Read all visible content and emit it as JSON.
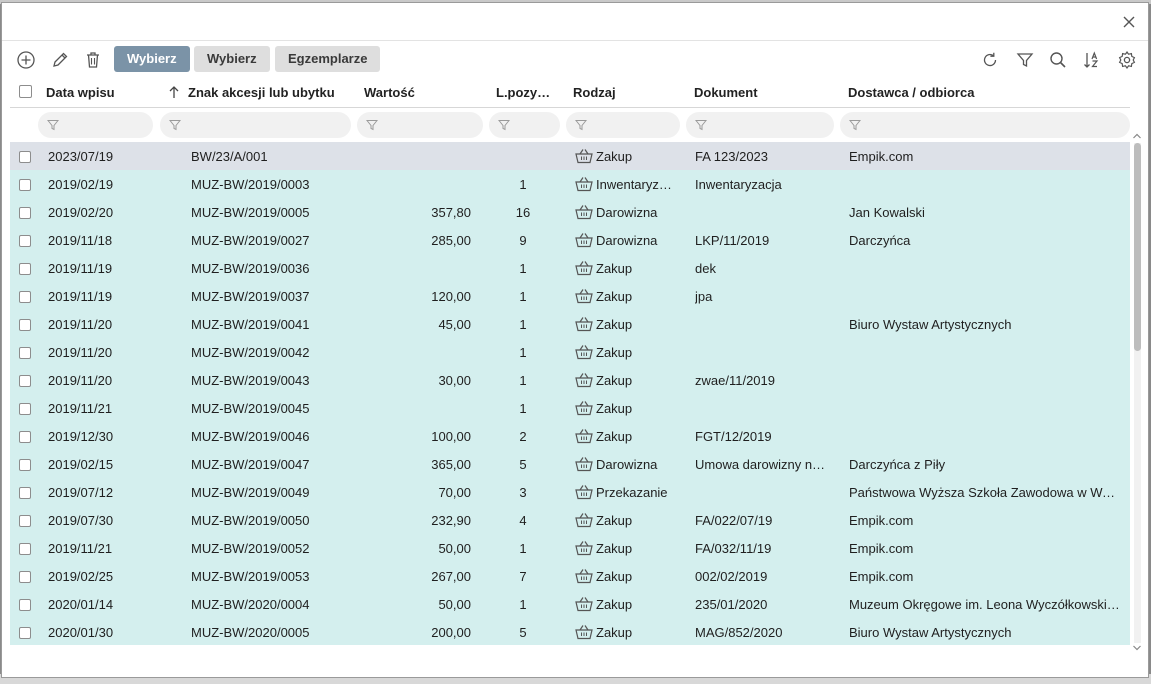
{
  "toolbar": {
    "buttons": [
      "Wybierz",
      "Wybierz",
      "Egzemplarze"
    ]
  },
  "columns": {
    "date": "Data wpisu",
    "sign": "Znak akcesji lub ubytku",
    "value": "Wartość",
    "positions": "L.pozy…",
    "type": "Rodzaj",
    "document": "Dokument",
    "supplier": "Dostawca / odbiorca"
  },
  "sort": {
    "column": "sign",
    "direction": "ascending"
  },
  "colors": {
    "row_bg": "#d4efee",
    "selected_row_bg": "#dde1e8",
    "primary_button": "#7b93a7"
  },
  "rows": [
    {
      "date": "2023/07/19",
      "sign": "BW/23/A/001",
      "value": "",
      "positions": "",
      "type": "Zakup",
      "document": "FA 123/2023",
      "supplier": "Empik.com",
      "selected": true
    },
    {
      "date": "2019/02/19",
      "sign": "MUZ-BW/2019/0003",
      "value": "",
      "positions": "1",
      "type": "Inwentaryz…",
      "document": "Inwentaryzacja",
      "supplier": ""
    },
    {
      "date": "2019/02/20",
      "sign": "MUZ-BW/2019/0005",
      "value": "357,80",
      "positions": "16",
      "type": "Darowizna",
      "document": "",
      "supplier": "Jan Kowalski"
    },
    {
      "date": "2019/11/18",
      "sign": "MUZ-BW/2019/0027",
      "value": "285,00",
      "positions": "9",
      "type": "Darowizna",
      "document": "LKP/11/2019",
      "supplier": "Darczyńca"
    },
    {
      "date": "2019/11/19",
      "sign": "MUZ-BW/2019/0036",
      "value": "",
      "positions": "1",
      "type": "Zakup",
      "document": "dek",
      "supplier": ""
    },
    {
      "date": "2019/11/19",
      "sign": "MUZ-BW/2019/0037",
      "value": "120,00",
      "positions": "1",
      "type": "Zakup",
      "document": "jpa",
      "supplier": ""
    },
    {
      "date": "2019/11/20",
      "sign": "MUZ-BW/2019/0041",
      "value": "45,00",
      "positions": "1",
      "type": "Zakup",
      "document": "",
      "supplier": "Biuro Wystaw Artystycznych"
    },
    {
      "date": "2019/11/20",
      "sign": "MUZ-BW/2019/0042",
      "value": "",
      "positions": "1",
      "type": "Zakup",
      "document": "",
      "supplier": ""
    },
    {
      "date": "2019/11/20",
      "sign": "MUZ-BW/2019/0043",
      "value": "30,00",
      "positions": "1",
      "type": "Zakup",
      "document": "zwae/11/2019",
      "supplier": ""
    },
    {
      "date": "2019/11/21",
      "sign": "MUZ-BW/2019/0045",
      "value": "",
      "positions": "1",
      "type": "Zakup",
      "document": "",
      "supplier": ""
    },
    {
      "date": "2019/12/30",
      "sign": "MUZ-BW/2019/0046",
      "value": "100,00",
      "positions": "2",
      "type": "Zakup",
      "document": "FGT/12/2019",
      "supplier": ""
    },
    {
      "date": "2019/02/15",
      "sign": "MUZ-BW/2019/0047",
      "value": "365,00",
      "positions": "5",
      "type": "Darowizna",
      "document": "Umowa darowizny n…",
      "supplier": "Darczyńca z Piły"
    },
    {
      "date": "2019/07/12",
      "sign": "MUZ-BW/2019/0049",
      "value": "70,00",
      "positions": "3",
      "type": "Przekazanie",
      "document": "",
      "supplier": "Państwowa Wyższa Szkoła Zawodowa w Wa…"
    },
    {
      "date": "2019/07/30",
      "sign": "MUZ-BW/2019/0050",
      "value": "232,90",
      "positions": "4",
      "type": "Zakup",
      "document": "FA/022/07/19",
      "supplier": "Empik.com"
    },
    {
      "date": "2019/11/21",
      "sign": "MUZ-BW/2019/0052",
      "value": "50,00",
      "positions": "1",
      "type": "Zakup",
      "document": "FA/032/11/19",
      "supplier": "Empik.com"
    },
    {
      "date": "2019/02/25",
      "sign": "MUZ-BW/2019/0053",
      "value": "267,00",
      "positions": "7",
      "type": "Zakup",
      "document": "002/02/2019",
      "supplier": "Empik.com"
    },
    {
      "date": "2020/01/14",
      "sign": "MUZ-BW/2020/0004",
      "value": "50,00",
      "positions": "1",
      "type": "Zakup",
      "document": "235/01/2020",
      "supplier": "Muzeum Okręgowe im. Leona Wyczółkowski…"
    },
    {
      "date": "2020/01/30",
      "sign": "MUZ-BW/2020/0005",
      "value": "200,00",
      "positions": "5",
      "type": "Zakup",
      "document": "MAG/852/2020",
      "supplier": "Biuro Wystaw Artystycznych"
    }
  ]
}
